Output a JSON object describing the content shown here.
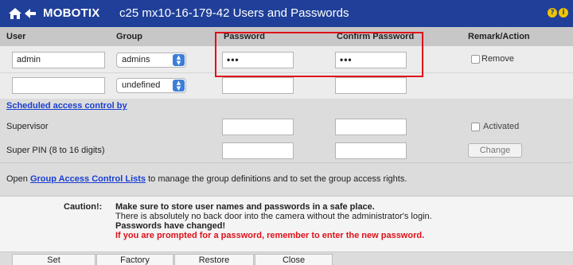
{
  "titlebar": {
    "brand": "MOBOTIX",
    "title": "c25  mx10-16-179-42 Users and Passwords",
    "help_glyph": "?",
    "info_glyph": "i"
  },
  "columns": {
    "user": "User",
    "group": "Group",
    "password": "Password",
    "confirm_password": "Confirm Password",
    "remark_action": "Remark/Action"
  },
  "users": [
    {
      "user": "admin",
      "group": "admins",
      "password": "•••",
      "confirm_password": "•••",
      "remove_label": "Remove"
    },
    {
      "user": "",
      "group": "undefined",
      "password": "",
      "confirm_password": ""
    }
  ],
  "scheduled_link": "Scheduled access control by",
  "supervisor": {
    "label": "Supervisor",
    "activated_label": "Activated"
  },
  "super_pin": {
    "label": "Super PIN (8 to 16 digits)",
    "change_label": "Change"
  },
  "group_acl": {
    "prefix": "Open ",
    "link": "Group Access Control Lists",
    "suffix": " to manage the group definitions and to set the group access rights."
  },
  "caution": {
    "label": "Caution!:",
    "line1": "Make sure to store user names and passwords in a safe place.",
    "line2": "There is absolutely no back door into the camera without the administrator's login.",
    "line3": "Passwords have changed!",
    "line4": "If you are prompted for a password, remember to enter the new password."
  },
  "buttons": {
    "set": "Set",
    "factory": "Factory",
    "restore": "Restore",
    "close": "Close"
  },
  "colors": {
    "titlebar": "#1f3f99",
    "header": "#c7c7c7",
    "highlight": "#e0101a",
    "link": "#1a3fd1"
  }
}
